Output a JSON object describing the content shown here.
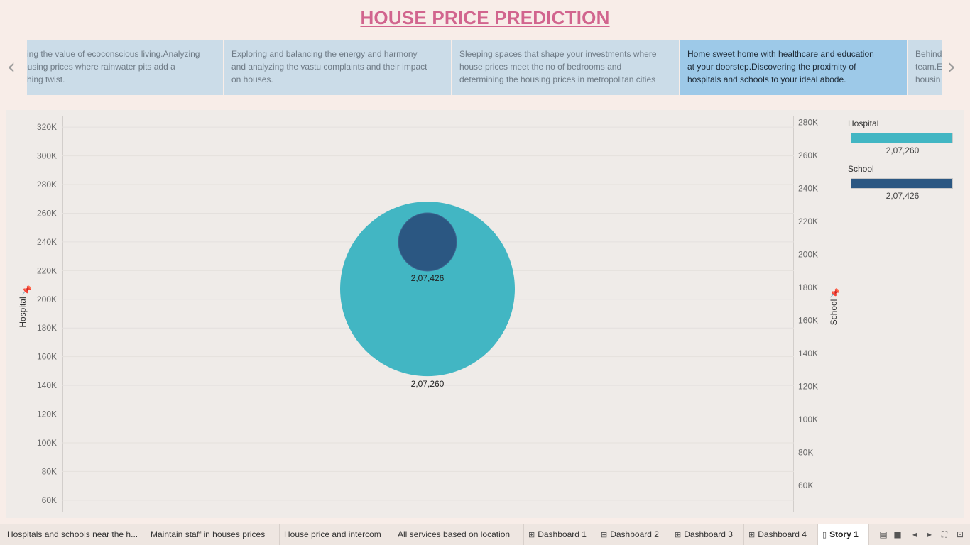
{
  "title": "HOUSE PRICE PREDICTION",
  "nav": {
    "prev_icon": "chevron-left-icon",
    "next_icon": "chevron-right-icon"
  },
  "story_points": [
    {
      "text": "king the value of ecoconscious living.Analyzing\nousing prices where rainwater pits add a\nshing twist.",
      "active": false
    },
    {
      "text": " Exploring and balancing the energy and harmony\nand analyzing the vastu complaints and their impact\non houses.",
      "active": false
    },
    {
      "text": "Sleeping spaces that shape your investments where\nhouse prices meet the no of bedrooms and\ndetermining the housing prices in metropolitan cities",
      "active": false
    },
    {
      "text": " Home sweet home with healthcare and education\nat your doorstep.Discovering the proximity of\nhospitals and schools to your ideal abode.",
      "active": true
    },
    {
      "text": "Behind\nteam.E\nhousin",
      "active": false
    }
  ],
  "chart_data": {
    "type": "scatter",
    "left_axis": {
      "label": "Hospital",
      "ticks": [
        "320K",
        "300K",
        "280K",
        "260K",
        "240K",
        "220K",
        "200K",
        "180K",
        "160K",
        "140K",
        "120K",
        "100K",
        "80K",
        "60K"
      ],
      "range": [
        52000,
        328000
      ]
    },
    "right_axis": {
      "label": "School",
      "ticks": [
        "280K",
        "260K",
        "240K",
        "220K",
        "200K",
        "180K",
        "160K",
        "140K",
        "120K",
        "100K",
        "80K",
        "60K"
      ],
      "range": [
        44000,
        284000
      ]
    },
    "series": [
      {
        "name": "Hospital",
        "value": 207260,
        "label": "2,07,260",
        "color": "#42b6c3",
        "axis": "left"
      },
      {
        "name": "School",
        "value": 207426,
        "label": "2,07,426",
        "color": "#2b5782",
        "axis": "right"
      }
    ],
    "grid": true
  },
  "legend": [
    {
      "title": "Hospital",
      "value": "2,07,260",
      "color": "#42b6c3"
    },
    {
      "title": "School",
      "value": "2,07,426",
      "color": "#2b5782"
    }
  ],
  "tabs": [
    {
      "label": "Hospitals and schools near the h...",
      "icon": ""
    },
    {
      "label": "Maintain staff in houses prices",
      "icon": ""
    },
    {
      "label": "House price and intercom",
      "icon": ""
    },
    {
      "label": "All services based on location",
      "icon": ""
    },
    {
      "label": "Dashboard 1",
      "icon": "⊞"
    },
    {
      "label": "Dashboard 2",
      "icon": "⊞"
    },
    {
      "label": "Dashboard 3",
      "icon": "⊞"
    },
    {
      "label": "Dashboard 4",
      "icon": "⊞"
    },
    {
      "label": "Story 1",
      "icon": "🕮"
    }
  ]
}
